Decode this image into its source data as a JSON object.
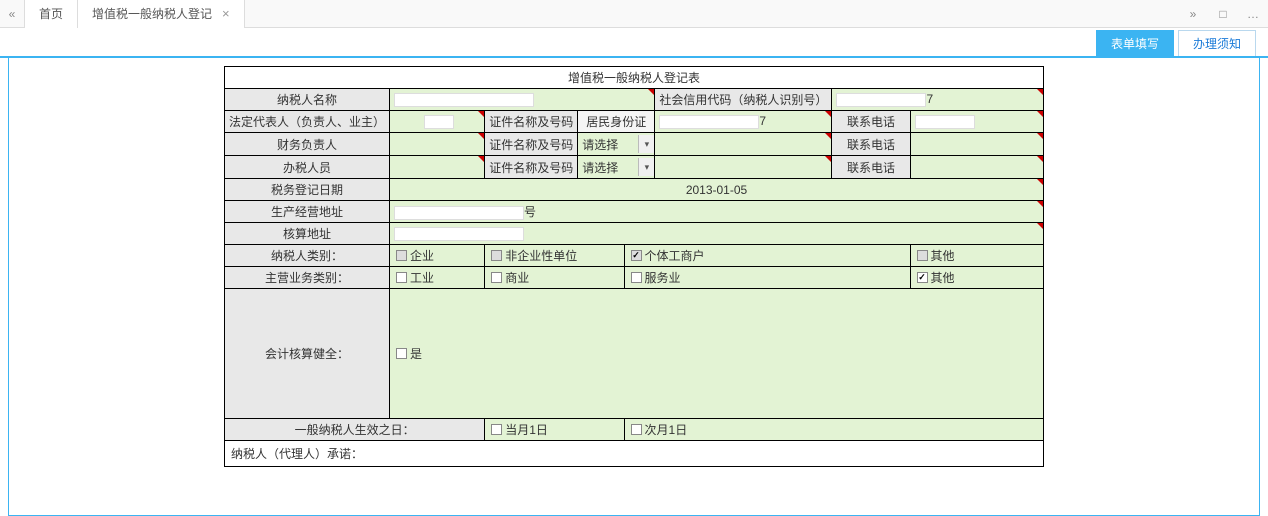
{
  "topbar": {
    "home": "首页",
    "tab_label": "增值税一般纳税人登记"
  },
  "subtabs": {
    "form_fill": "表单填写",
    "instructions": "办理须知"
  },
  "form": {
    "title": "增值税一般纳税人登记表",
    "labels": {
      "taxpayer_name": "纳税人名称",
      "credit_code": "社会信用代码（纳税人识别号）",
      "legal_rep": "法定代表人（负责人、业主）",
      "cert_name_no": "证件名称及号码",
      "resident_id": "居民身份证",
      "contact_phone": "联系电话",
      "finance_head": "财务负责人",
      "handler": "办税人员",
      "please_select": "请选择",
      "tax_reg_date": "税务登记日期",
      "biz_address": "生产经营地址",
      "acct_address": "核算地址",
      "taxpayer_type": "纳税人类别：",
      "main_biz_type": "主营业务类别：",
      "acct_sound": "会计核算健全：",
      "effective_date": "一般纳税人生效之日：",
      "promise": "纳税人（代理人）承诺："
    },
    "values": {
      "taxpayer_name": "",
      "credit_code_suffix": "7",
      "legal_rep_suffix": "",
      "resident_id_suffix": "7",
      "tax_reg_date": "2013-01-05",
      "biz_address_suffix": "号",
      "acct_address_suffix": ""
    },
    "taxpayer_types": {
      "enterprise": "企业",
      "non_enterprise": "非企业性单位",
      "individual": "个体工商户",
      "other": "其他"
    },
    "biz_types": {
      "industry": "工业",
      "commerce": "商业",
      "service": "服务业",
      "other": "其他"
    },
    "acct_sound_opt": "是",
    "effective_opts": {
      "this_month": "当月1日",
      "next_month": "次月1日"
    }
  }
}
